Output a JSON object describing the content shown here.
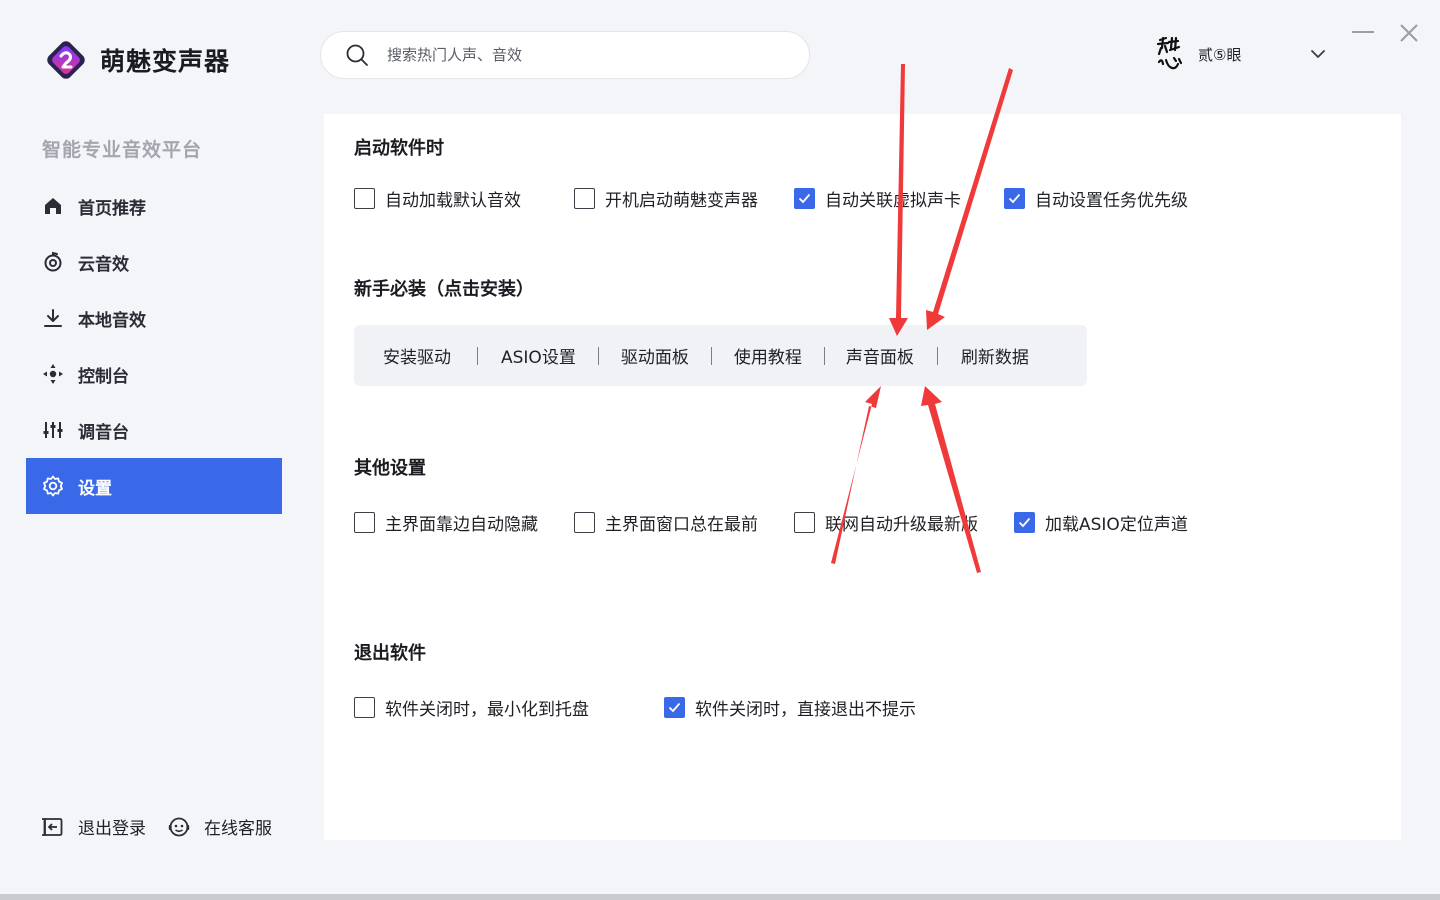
{
  "app": {
    "name": "萌魅变声器",
    "brand_color": "#3968e8"
  },
  "search": {
    "placeholder": "搜索热门人声、音效",
    "icon": "search-icon"
  },
  "user": {
    "name": "贰⑤眼",
    "avatar_icon": "calligraphy-avatar"
  },
  "sidebar": {
    "title": "智能专业音效平台",
    "items": [
      {
        "label": "首页推荐",
        "icon": "home-icon",
        "active": false
      },
      {
        "label": "云音效",
        "icon": "cloud-sound-icon",
        "active": false
      },
      {
        "label": "本地音效",
        "icon": "download-icon",
        "active": false
      },
      {
        "label": "控制台",
        "icon": "control-icon",
        "active": false
      },
      {
        "label": "调音台",
        "icon": "mixer-icon",
        "active": false
      },
      {
        "label": "设置",
        "icon": "gear-icon",
        "active": true
      }
    ],
    "footer": {
      "logout": "退出登录",
      "support": "在线客服"
    }
  },
  "settings": {
    "startup": {
      "title": "启动软件时",
      "options": [
        {
          "label": "自动加载默认音效",
          "checked": false
        },
        {
          "label": "开机启动萌魅变声器",
          "checked": false
        },
        {
          "label": "自动关联虚拟声卡",
          "checked": true
        },
        {
          "label": "自动设置任务优先级",
          "checked": true
        }
      ]
    },
    "essentials": {
      "title": "新手必装（点击安装）",
      "tools": [
        "安装驱动",
        "ASIO设置",
        "驱动面板",
        "使用教程",
        "声音面板",
        "刷新数据"
      ]
    },
    "other": {
      "title": "其他设置",
      "options": [
        {
          "label": "主界面靠边自动隐藏",
          "checked": false
        },
        {
          "label": "主界面窗口总在最前",
          "checked": false
        },
        {
          "label": "联网自动升级最新版",
          "checked": false
        },
        {
          "label": "加载ASIO定位声道",
          "checked": true
        }
      ]
    },
    "exit": {
      "title": "退出软件",
      "options": [
        {
          "label": "软件关闭时，最小化到托盘",
          "checked": false
        },
        {
          "label": "软件关闭时，直接退出不提示",
          "checked": true
        }
      ]
    }
  },
  "annotation_color": "#f03a3a"
}
